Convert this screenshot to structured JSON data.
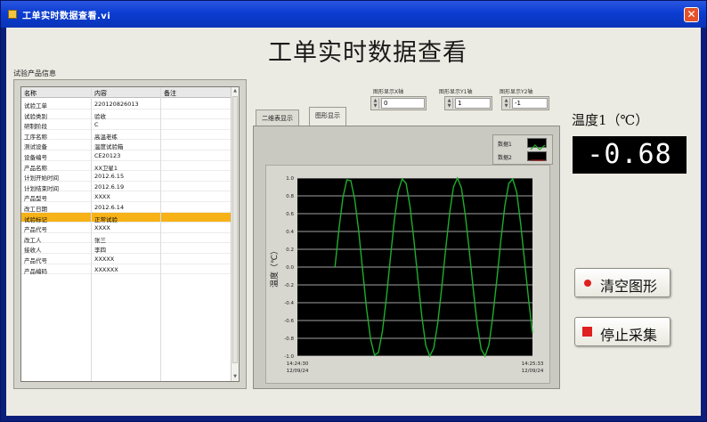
{
  "window": {
    "title": "工单实时数据查看.vi"
  },
  "main_title": "工单实时数据查看",
  "info": {
    "label": "试验产品信息",
    "headers": [
      "名称",
      "内容",
      "备注"
    ],
    "rows": [
      {
        "name": "试验工单",
        "value": "220120826013",
        "note": ""
      },
      {
        "name": "试验类别",
        "value": "验收",
        "note": ""
      },
      {
        "name": "研制阶段",
        "value": "C",
        "note": ""
      },
      {
        "name": "工序名称",
        "value": "高温老练",
        "note": ""
      },
      {
        "name": "测试设备",
        "value": "温度试验箱",
        "note": ""
      },
      {
        "name": "设备编号",
        "value": "CE20123",
        "note": ""
      },
      {
        "name": "产品名称",
        "value": "XX卫星1",
        "note": ""
      },
      {
        "name": "计划开始时间",
        "value": "2012.6.15",
        "note": ""
      },
      {
        "name": "计划结束时间",
        "value": "2012.6.19",
        "note": ""
      },
      {
        "name": "产品型号",
        "value": "XXXX",
        "note": ""
      },
      {
        "name": "改工日期",
        "value": "2012.6.14",
        "note": ""
      },
      {
        "name": "试验标记",
        "value": "正常试验",
        "note": "",
        "selected": true
      },
      {
        "name": "产品代号",
        "value": "XXXX",
        "note": ""
      },
      {
        "name": "改工人",
        "value": "张三",
        "note": ""
      },
      {
        "name": "接收人",
        "value": "李四",
        "note": ""
      },
      {
        "name": "产品代号",
        "value": "XXXXX",
        "note": ""
      },
      {
        "name": "产品编码",
        "value": "XXXXXX",
        "note": ""
      }
    ]
  },
  "tabs": [
    {
      "label": "二维表显示",
      "active": false
    },
    {
      "label": "图形显示",
      "active": true
    }
  ],
  "controls": [
    {
      "label": "图形显示X轴",
      "value": "0"
    },
    {
      "label": "图形显示Y1轴",
      "value": "1"
    },
    {
      "label": "图形显示Y2轴",
      "value": "-1"
    }
  ],
  "legend": [
    {
      "name": "数据1",
      "color": "#1dae2a"
    },
    {
      "name": "数据2",
      "color": "#9b1b1b"
    }
  ],
  "temperature": {
    "label": "温度1（℃）",
    "value": "-0.68"
  },
  "buttons": {
    "clear": "清空图形",
    "stop": "停止采集"
  },
  "chart_data": {
    "type": "line",
    "title": "",
    "xlabel": "",
    "ylabel": "温度（℃）",
    "ylim": [
      -1,
      1
    ],
    "yticks": [
      "1.0",
      "0.8",
      "0.6",
      "0.4",
      "0.2",
      "0.0",
      "-0.2",
      "-0.4",
      "-0.6",
      "-0.8",
      "-1.0"
    ],
    "xticks": [
      {
        "time": "14:24:30",
        "date": "12/09/24"
      },
      {
        "time": "14:25:33",
        "date": "12/09/24"
      }
    ],
    "grid": true,
    "background": "#000000",
    "series": [
      {
        "name": "数据1",
        "color": "#1dae2a",
        "x": [
          0,
          0.02,
          0.04,
          0.06,
          0.08,
          0.1,
          0.12,
          0.14,
          0.16,
          0.18,
          0.2,
          0.22,
          0.24,
          0.26,
          0.28,
          0.3,
          0.32,
          0.34,
          0.36,
          0.38,
          0.4,
          0.42,
          0.44,
          0.46,
          0.48,
          0.5,
          0.52,
          0.54,
          0.56,
          0.58,
          0.6,
          0.62,
          0.64,
          0.66,
          0.68,
          0.7,
          0.72,
          0.74,
          0.76,
          0.78,
          0.8,
          0.82,
          0.84,
          0.86,
          0.88,
          0.9,
          0.92,
          0.94,
          0.96,
          0.98,
          1.0
        ],
        "values": [
          0,
          0.43,
          0.78,
          0.98,
          0.97,
          0.76,
          0.4,
          -0.04,
          -0.47,
          -0.81,
          -0.99,
          -0.96,
          -0.72,
          -0.35,
          0.09,
          0.52,
          0.85,
          0.99,
          0.94,
          0.68,
          0.3,
          -0.14,
          -0.56,
          -0.88,
          -1.0,
          -0.91,
          -0.63,
          -0.24,
          0.19,
          0.6,
          0.9,
          1.0,
          0.89,
          0.58,
          0.19,
          -0.25,
          -0.64,
          -0.92,
          -1.0,
          -0.87,
          -0.54,
          -0.13,
          0.3,
          0.69,
          0.94,
          0.99,
          0.84,
          0.49,
          0.07,
          -0.36,
          -0.74
        ]
      }
    ]
  }
}
